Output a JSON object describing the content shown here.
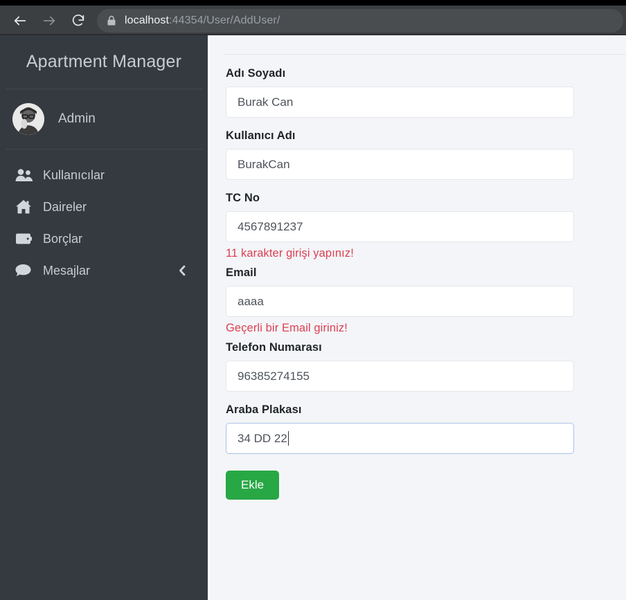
{
  "browser": {
    "back_icon": "arrow-left-icon",
    "forward_icon": "arrow-right-icon",
    "reload_icon": "reload-icon",
    "lock_icon": "lock-icon",
    "url_host": "localhost",
    "url_rest": ":44354/User/AddUser/",
    "url_full": "localhost:44354/User/AddUser/"
  },
  "sidebar": {
    "brand": "Apartment Manager",
    "user": {
      "name": "Admin",
      "avatar_icon": "user-avatar-photo"
    },
    "items": [
      {
        "label": "Kullanıcılar",
        "icon": "users-icon"
      },
      {
        "label": "Daireler",
        "icon": "home-icon"
      },
      {
        "label": "Borçlar",
        "icon": "wallet-icon"
      },
      {
        "label": "Mesajlar",
        "icon": "chat-bubble-icon",
        "chevron": "chevron-left-icon"
      }
    ]
  },
  "form": {
    "fields": [
      {
        "label": "Adı Soyadı",
        "value": "Burak Can",
        "error": "",
        "focused": false
      },
      {
        "label": "Kullanıcı Adı",
        "value": "BurakCan",
        "error": "",
        "focused": false
      },
      {
        "label": "TC No",
        "value": "4567891237",
        "error": "11 karakter girişi yapınız!",
        "focused": false
      },
      {
        "label": "Email",
        "value": "aaaa",
        "error": "Geçerli bir Email giriniz!",
        "focused": false
      },
      {
        "label": "Telefon Numarası",
        "value": "96385274155",
        "error": "",
        "focused": false
      },
      {
        "label": "Araba Plakası",
        "value": "34 DD 22",
        "error": "",
        "focused": true
      }
    ],
    "submit_label": "Ekle"
  },
  "colors": {
    "sidebar_bg": "#343a40",
    "content_bg": "#f4f5f8",
    "accent_success": "#28a745",
    "error_text": "#dc3f52",
    "input_border": "#e3e6ea",
    "input_border_focus": "#a8c3e8",
    "browser_toolbar": "#3c3f41"
  }
}
